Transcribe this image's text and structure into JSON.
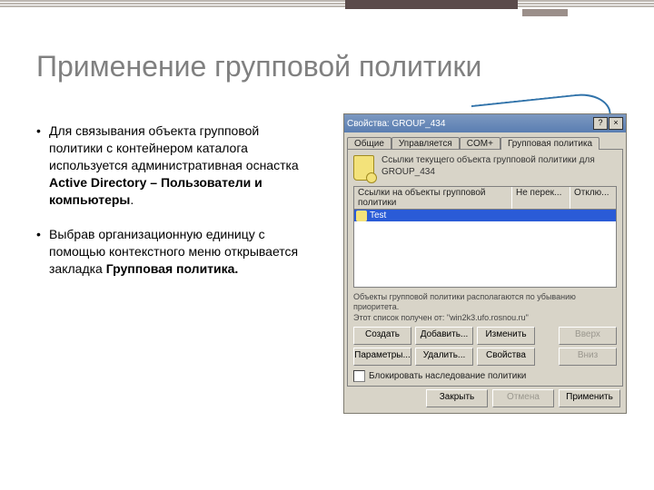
{
  "slide": {
    "title": "Применение групповой политики",
    "bullet1_pre": "Для связывания объекта групповой политики с контейнером каталога используется административная оснастка ",
    "bullet1_bold": "Active Directory – Пользователи и компьютеры",
    "bullet1_post": ".",
    "bullet2_pre": "Выбрав организационную единицу с помощью контекстного меню открывается закладка ",
    "bullet2_bold": "Групповая политика.",
    "bullet2_post": ""
  },
  "dialog": {
    "title": "Свойства: GROUP_434",
    "titlebar": {
      "help": "?",
      "close": "×"
    },
    "tabs": [
      "Общие",
      "Управляется",
      "COM+",
      "Групповая политика"
    ],
    "active_tab": 3,
    "desc": "Ссылки текущего объекта групповой политики для GROUP_434",
    "columns": {
      "c1": "Ссылки на объекты групповой политики",
      "c2": "Не перек...",
      "c3": "Отклю..."
    },
    "row1": "Test",
    "hint1": "Объекты групповой политики располагаются по убыванию приоритета.",
    "hint2": "Этот список получен от: \"win2k3.ufo.rosnou.ru\"",
    "buttons": {
      "create": "Создать",
      "add": "Добавить...",
      "edit": "Изменить",
      "up": "Вверх",
      "options": "Параметры...",
      "delete": "Удалить...",
      "props": "Свойства",
      "down": "Вниз"
    },
    "checkbox": "Блокировать наследование политики",
    "footer": {
      "close": "Закрыть",
      "cancel": "Отмена",
      "apply": "Применить"
    }
  }
}
